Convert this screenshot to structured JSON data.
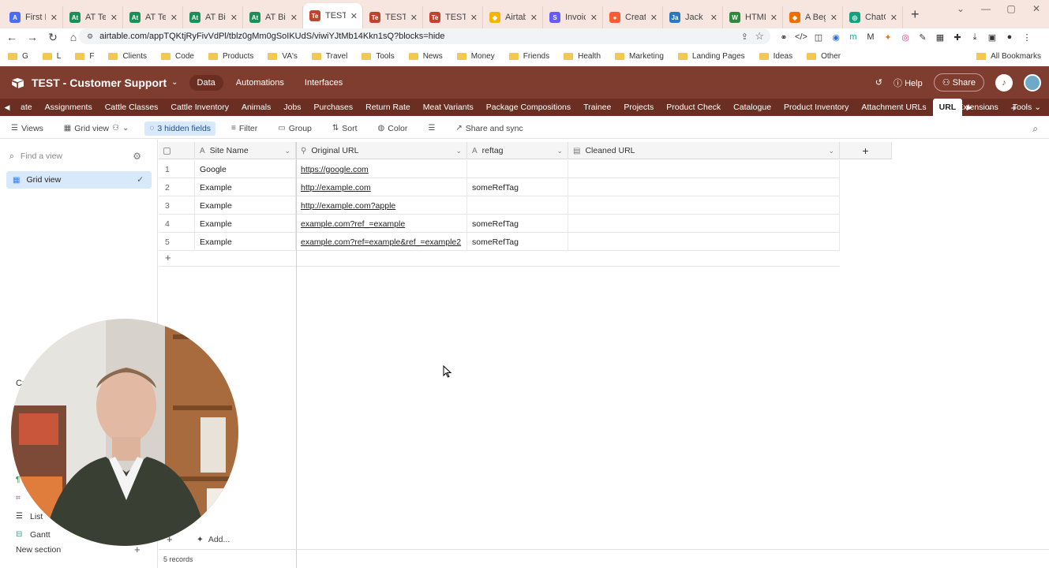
{
  "browser": {
    "tabs": [
      {
        "label": "First Bi",
        "fav": "A",
        "color": "#4a6cf7"
      },
      {
        "label": "AT Test",
        "fav": "At",
        "color": "#1b8f5a"
      },
      {
        "label": "AT Tes",
        "fav": "At",
        "color": "#1b8f5a"
      },
      {
        "label": "AT Biz",
        "fav": "At",
        "color": "#1b8f5a"
      },
      {
        "label": "AT Biz",
        "fav": "At",
        "color": "#1b8f5a"
      },
      {
        "label": "TEST -",
        "fav": "Te",
        "color": "#c0442b",
        "active": true
      },
      {
        "label": "TEST: T",
        "fav": "Te",
        "color": "#c0442b"
      },
      {
        "label": "TEST -",
        "fav": "Te",
        "color": "#c0442b"
      },
      {
        "label": "Airtabl",
        "fav": "◆",
        "color": "#f4b400"
      },
      {
        "label": "Invoice",
        "fav": "S",
        "color": "#635bff"
      },
      {
        "label": "Create",
        "fav": "●",
        "color": "#ff5a36"
      },
      {
        "label": "Jack M",
        "fav": "Ja",
        "color": "#2a7ac2"
      },
      {
        "label": "HTML",
        "fav": "W",
        "color": "#2b8a3e"
      },
      {
        "label": "A Begi",
        "fav": "◈",
        "color": "#ef6c00"
      },
      {
        "label": "ChatGI",
        "fav": "◎",
        "color": "#10a37f"
      }
    ],
    "url": "airtable.com/appTQKtjRyFivVdPl/tblz0gMm0gSoIKUdS/viwiYJtMb14Kkn1sQ?blocks=hide",
    "bookmarks": [
      "G",
      "L",
      "F",
      "Clients",
      "Code",
      "Products",
      "VA's",
      "Travel",
      "Tools",
      "News",
      "Money",
      "Friends",
      "Health",
      "Marketing",
      "Landing Pages",
      "Ideas",
      "Other"
    ],
    "all_bookmarks": "All Bookmarks"
  },
  "app": {
    "base_name": "TEST - Customer Support",
    "nav": {
      "data": "Data",
      "automations": "Automations",
      "interfaces": "Interfaces"
    },
    "help": "Help",
    "share": "Share",
    "tables": [
      "ate",
      "Assignments",
      "Cattle Classes",
      "Cattle Inventory",
      "Animals",
      "Jobs",
      "Purchases",
      "Return Rate",
      "Meat Variants",
      "Package Compositions",
      "Trainee",
      "Projects",
      "Product Check",
      "Catalogue",
      "Product Inventory",
      "Attachment URLs"
    ],
    "active_table": "URL",
    "extensions": "Extensions",
    "tools": "Tools"
  },
  "viewbar": {
    "views": "Views",
    "grid_view": "Grid view",
    "hidden_fields": "3 hidden fields",
    "filter": "Filter",
    "group": "Group",
    "sort": "Sort",
    "color": "Color",
    "share_sync": "Share and sync"
  },
  "sidebar": {
    "find_placeholder": "Find a view",
    "grid_view": "Grid view",
    "create_label": "Cr",
    "list": "List",
    "gantt": "Gantt",
    "new_section": "New section"
  },
  "grid": {
    "columns": [
      {
        "name": "Site Name",
        "type_icon": "A"
      },
      {
        "name": "Original URL",
        "type_icon": "🔗"
      },
      {
        "name": "reftag",
        "type_icon": "A"
      },
      {
        "name": "Cleaned URL",
        "type_icon": "▤"
      }
    ],
    "rows": [
      {
        "n": "1",
        "site": "Google",
        "url": "https://google.com",
        "reftag": "",
        "cleaned": ""
      },
      {
        "n": "2",
        "site": "Example",
        "url": "http://example.com",
        "reftag": "someRefTag",
        "cleaned": ""
      },
      {
        "n": "3",
        "site": "Example",
        "url": "http://example.com?apple",
        "reftag": "",
        "cleaned": ""
      },
      {
        "n": "4",
        "site": "Example",
        "url": "example.com?ref_=example",
        "reftag": "someRefTag",
        "cleaned": ""
      },
      {
        "n": "5",
        "site": "Example",
        "url": "example.com?ref=example&ref_=example2",
        "reftag": "someRefTag",
        "cleaned": ""
      }
    ],
    "add_more": "Add...",
    "record_count": "5 records"
  }
}
